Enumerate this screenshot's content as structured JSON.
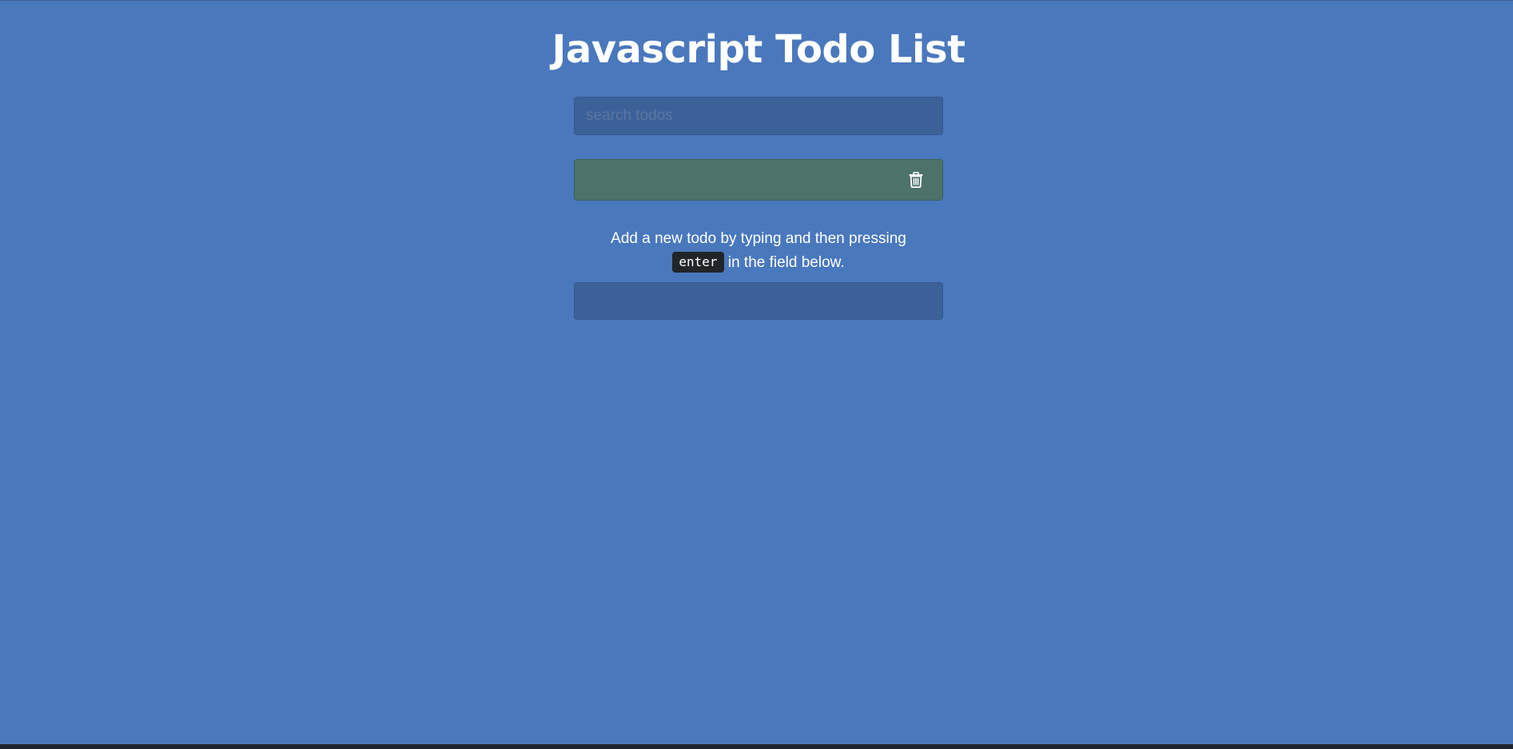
{
  "header": {
    "title": "Javascript Todo List"
  },
  "search": {
    "value": "",
    "placeholder": "search todos"
  },
  "todos": [
    {
      "text": "",
      "delete_icon": "trash-icon"
    }
  ],
  "add_hint": {
    "before": "Add a new todo by typing and then pressing",
    "key": "enter",
    "after": "in the field below."
  },
  "add_field": {
    "value": "",
    "placeholder": ""
  },
  "colors": {
    "background": "#4a78bd",
    "input_background": "#3c6199",
    "todo_background": "#4c726a",
    "kbd_background": "#212529",
    "text": "#ffffff"
  }
}
